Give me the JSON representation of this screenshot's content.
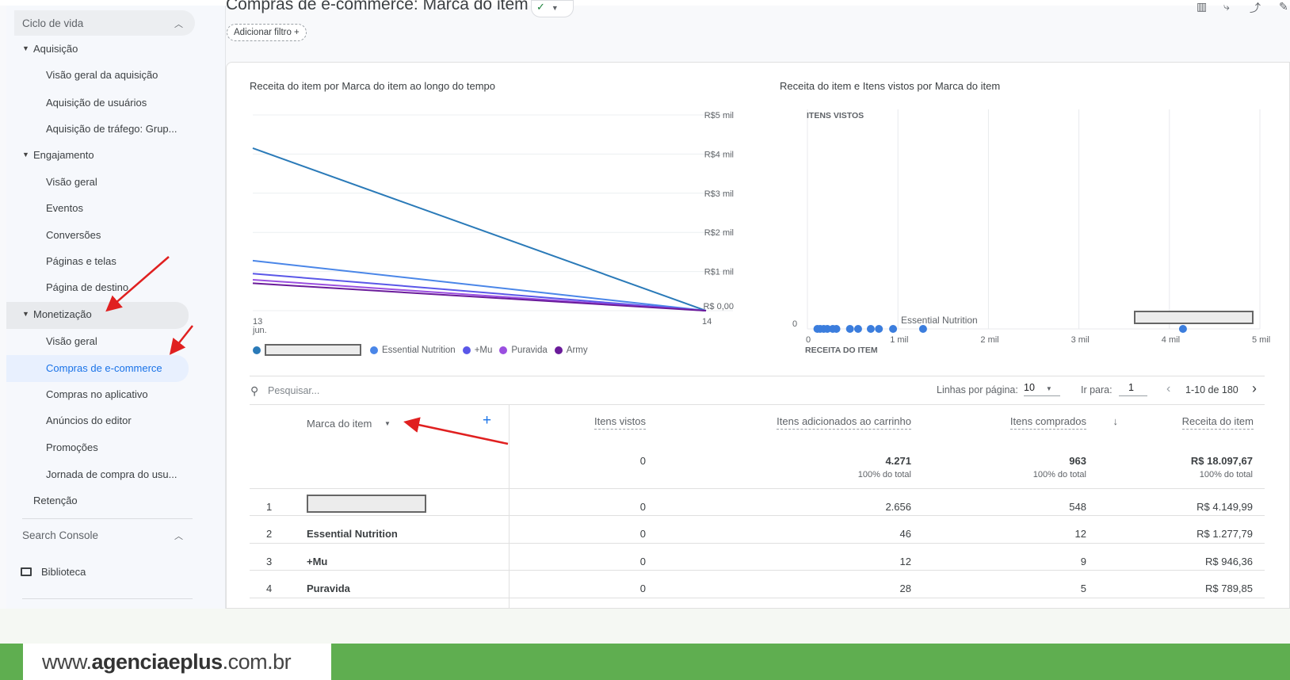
{
  "sidebar": {
    "lifecycle": "Ciclo de vida",
    "acquisition": {
      "label": "Aquisição",
      "items": [
        "Visão geral da aquisição",
        "Aquisição de usuários",
        "Aquisição de tráfego: Grup..."
      ]
    },
    "engagement": {
      "label": "Engajamento",
      "items": [
        "Visão geral",
        "Eventos",
        "Conversões",
        "Páginas e telas",
        "Página de destino"
      ]
    },
    "monetization": {
      "label": "Monetização",
      "items": [
        "Visão geral",
        "Compras de e-commerce",
        "Compras no aplicativo",
        "Anúncios do editor",
        "Promoções",
        "Jornada de compra do usu..."
      ]
    },
    "retention": "Retenção",
    "search_console": "Search Console",
    "library": "Biblioteca",
    "active_item": "Compras de e-commerce"
  },
  "header": {
    "title": "Compras de e-commerce: Marca do item",
    "add_filter": "Adicionar filtro +",
    "status_icon": "check-circle-icon"
  },
  "chart_data": [
    {
      "type": "line",
      "title": "Receita do item por Marca do item ao longo do tempo",
      "x": [
        "13\njun.",
        "14"
      ],
      "x_labels": [
        "13",
        "jun.",
        "14"
      ],
      "y_ticks": [
        "R$5 mil",
        "R$4 mil",
        "R$3 mil",
        "R$2 mil",
        "R$1 mil",
        "R$ 0,00"
      ],
      "ylim": [
        0,
        5000
      ],
      "series": [
        {
          "name": "",
          "redacted": true,
          "color": "#2a7ab8",
          "values": [
            4149.99,
            0
          ]
        },
        {
          "name": "Essential Nutrition",
          "color": "#4a86e8",
          "values": [
            1277.79,
            0
          ]
        },
        {
          "name": "+Mu",
          "color": "#5a57e8",
          "values": [
            946.36,
            0
          ]
        },
        {
          "name": "Puravida",
          "color": "#9b4fe0",
          "values": [
            789.85,
            0
          ]
        },
        {
          "name": "Army",
          "color": "#6a1b9a",
          "values": [
            700,
            0
          ]
        }
      ]
    },
    {
      "type": "scatter",
      "title": "Receita do item e Itens vistos por Marca do item",
      "ylabel": "ITENS VISTOS",
      "xlabel": "RECEITA DO ITEM",
      "x_ticks": [
        "0",
        "1 mil",
        "2 mil",
        "3 mil",
        "4 mil",
        "5 mil"
      ],
      "y_ticks": [
        "0"
      ],
      "xlim": [
        0,
        5000
      ],
      "point_label": "Essential Nutrition",
      "color": "#3b7ddd",
      "points": [
        [
          4149.99,
          0
        ],
        [
          1277.79,
          0
        ],
        [
          946.36,
          0
        ],
        [
          789.85,
          0
        ],
        [
          700,
          0
        ],
        [
          560,
          0
        ],
        [
          470,
          0
        ],
        [
          320,
          0
        ],
        [
          280,
          0
        ],
        [
          220,
          0
        ],
        [
          180,
          0
        ],
        [
          140,
          0
        ],
        [
          110,
          0
        ]
      ]
    }
  ],
  "legend_redacted": true,
  "table": {
    "search_placeholder": "Pesquisar...",
    "rows_per_page_label": "Linhas por página:",
    "rows_per_page": "10",
    "goto_label": "Ir para:",
    "goto_value": "1",
    "range": "1-10 de 180",
    "dimension": "Marca do item",
    "columns": [
      "Itens vistos",
      "Itens adicionados ao carrinho",
      "Itens comprados",
      "Receita do item"
    ],
    "totals": [
      "0",
      "4.271",
      "963",
      "R$ 18.097,67"
    ],
    "total_pct": "100% do total",
    "rows": [
      {
        "rank": "1",
        "brand": "",
        "redacted": true,
        "values": [
          "0",
          "2.656",
          "548",
          "R$ 4.149,99"
        ]
      },
      {
        "rank": "2",
        "brand": "Essential Nutrition",
        "values": [
          "0",
          "46",
          "12",
          "R$ 1.277,79"
        ]
      },
      {
        "rank": "3",
        "brand": "+Mu",
        "values": [
          "0",
          "12",
          "9",
          "R$ 946,36"
        ]
      },
      {
        "rank": "4",
        "brand": "Puravida",
        "values": [
          "0",
          "28",
          "5",
          "R$ 789,85"
        ]
      }
    ]
  },
  "footer": {
    "url_prefix": "www.",
    "url_brand": "agenciaeplus",
    "url_suffix": ".com.br",
    "brand_color": "#5fae50"
  }
}
